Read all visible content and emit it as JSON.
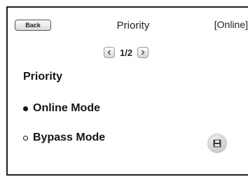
{
  "header": {
    "back_label": "Back",
    "title": "Priority",
    "status": "[Online]"
  },
  "pager": {
    "text": "1/2",
    "prev_icon": "chevron-left-icon",
    "next_icon": "chevron-right-icon"
  },
  "content": {
    "section_label": "Priority",
    "options": [
      {
        "label": "Online Mode",
        "selected": true
      },
      {
        "label": "Bypass Mode",
        "selected": false
      }
    ]
  },
  "actions": {
    "save_icon": "save-icon"
  }
}
